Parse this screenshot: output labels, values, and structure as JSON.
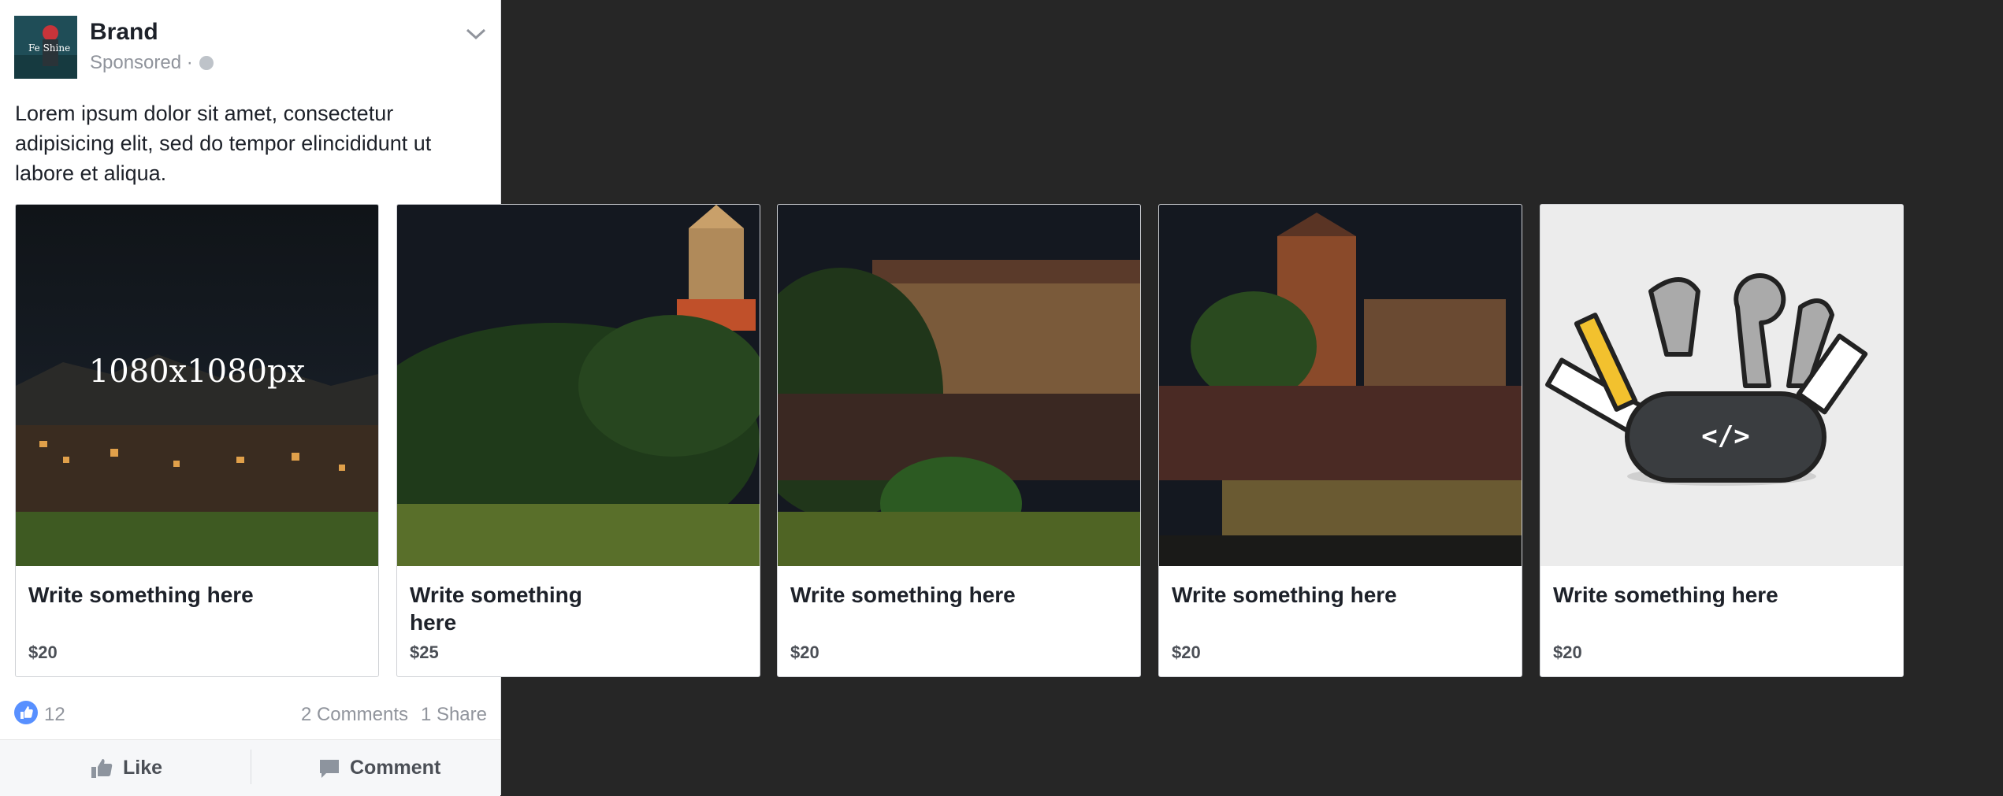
{
  "post": {
    "brand_name": "Brand",
    "sponsored_label": "Sponsored ·",
    "caption": "Lorem ipsum dolor sit amet, consectetur adipisicing elit, sed do tempor elincididunt ut labore et aliqua.",
    "avatar_text": "Fe Shine"
  },
  "carousel": {
    "cards": [
      {
        "image_label": "1080x1080px",
        "title": "Write something here",
        "price": "$20"
      },
      {
        "title": "Write something\nhere",
        "price": "$25"
      },
      {
        "title": "Write something here",
        "price": "$20"
      },
      {
        "title": "Write something here",
        "price": "$20"
      },
      {
        "title": "Write something here",
        "price": "$20"
      }
    ]
  },
  "stats": {
    "likes": "12",
    "comments": "2 Comments",
    "shares": "1 Share"
  },
  "actions": {
    "like_label": "Like",
    "comment_label": "Comment"
  },
  "colors": {
    "background": "#262626",
    "like_blue": "#5890ff",
    "text_dark": "#1d2129",
    "text_muted": "#90949c"
  }
}
